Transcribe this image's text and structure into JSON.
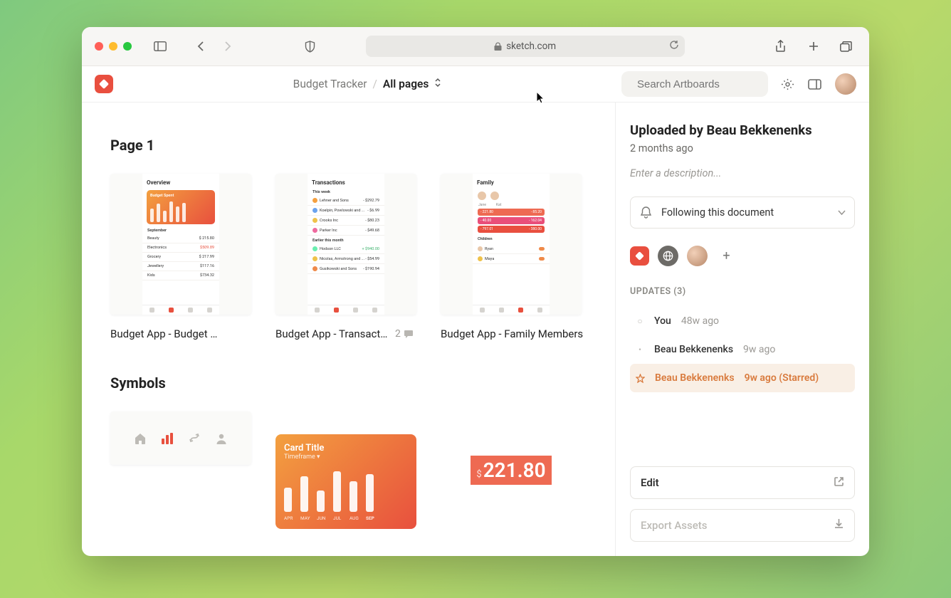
{
  "browser": {
    "url": "sketch.com"
  },
  "toolbar": {
    "doc_name": "Budget Tracker",
    "page_selector": "All pages",
    "search_placeholder": "Search Artboards"
  },
  "sections": {
    "page1_title": "Page 1",
    "symbols_title": "Symbols"
  },
  "artboards": [
    {
      "label": "Budget App - Budget Overvi...",
      "comments": ""
    },
    {
      "label": "Budget App - Transacti...",
      "comments": "2"
    },
    {
      "label": "Budget App - Family Members",
      "comments": ""
    }
  ],
  "symbol_chart": {
    "title": "Card Title",
    "subtitle": "Timeframe",
    "months": [
      "APR",
      "MAY",
      "JUN",
      "JUL",
      "AUG",
      "SEP"
    ]
  },
  "symbol_price": {
    "currency": "$",
    "value": "221.80"
  },
  "sidebar": {
    "uploaded_by": "Uploaded by Beau Bekkenenks",
    "when": "2 months ago",
    "desc_placeholder": "Enter a description...",
    "follow": "Following this document",
    "updates_label": "UPDATES (3)",
    "updates": [
      {
        "marker": "○",
        "name": "You",
        "time": "48w ago",
        "starred": false
      },
      {
        "marker": "•",
        "name": "Beau Bekkenenks",
        "time": "9w ago",
        "starred": false
      },
      {
        "marker": "★",
        "name": "Beau Bekkenenks",
        "time": "9w ago (Starred)",
        "starred": true
      }
    ],
    "edit_label": "Edit",
    "export_label": "Export Assets"
  },
  "mock_overview": {
    "title": "Overview",
    "card": "Budget Spent",
    "month": "September",
    "rows": [
      {
        "l": "Beauty",
        "r": "$ 215.80"
      },
      {
        "l": "Electronics",
        "r": "$509.89"
      },
      {
        "l": "Grocery",
        "r": "$ 217.99"
      },
      {
        "l": "Jewellery",
        "r": "$117.16"
      },
      {
        "l": "Kids",
        "r": "$734.32"
      }
    ]
  },
  "mock_transactions": {
    "title": "Transactions",
    "h1": "This week",
    "h2": "Earlier this month",
    "rows1": [
      {
        "l": "Lehner and Sons",
        "r": "- $292.79"
      },
      {
        "l": "Koelpin, Powlowski and ...",
        "r": "- $6.99"
      },
      {
        "l": "Crooks Inc",
        "r": "- $80.23"
      },
      {
        "l": "Parker Inc",
        "r": "- $49.68"
      }
    ],
    "rows2": [
      {
        "l": "Hodson LLC",
        "r": "+ $940.00"
      },
      {
        "l": "Nicolas, Armstrong and ...",
        "r": "- $54.99"
      },
      {
        "l": "Gusikowski and Sons",
        "r": "- $190.94"
      }
    ]
  },
  "mock_family": {
    "title": "Family",
    "labels": [
      "Jane",
      "Kat"
    ],
    "pills": [
      [
        "- 221.80",
        "- 85.20"
      ],
      [
        "- 40.00",
        "- 162.04"
      ],
      [
        "- 797.01",
        "- 380.00"
      ]
    ],
    "children": "Children"
  }
}
